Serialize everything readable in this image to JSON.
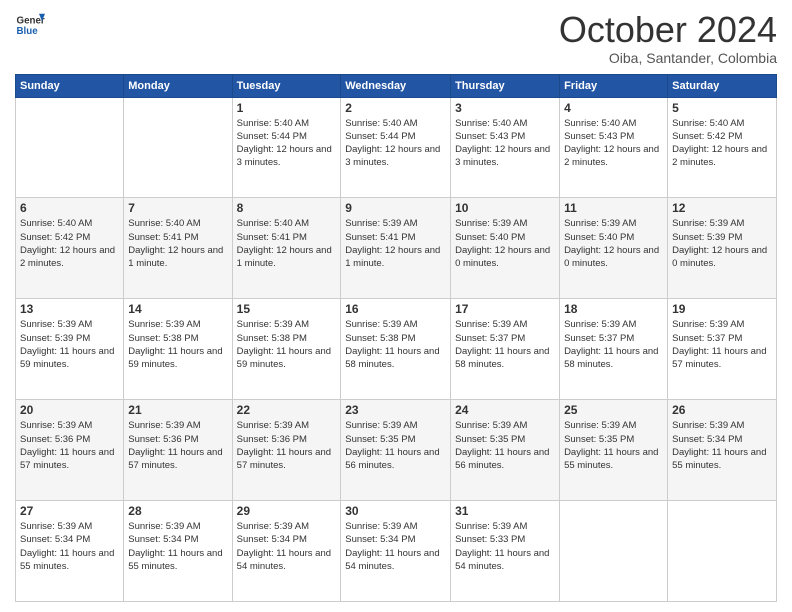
{
  "logo": {
    "line1": "General",
    "line2": "Blue"
  },
  "title": "October 2024",
  "location": "Oiba, Santander, Colombia",
  "weekdays": [
    "Sunday",
    "Monday",
    "Tuesday",
    "Wednesday",
    "Thursday",
    "Friday",
    "Saturday"
  ],
  "weeks": [
    [
      {
        "day": "",
        "info": ""
      },
      {
        "day": "",
        "info": ""
      },
      {
        "day": "1",
        "info": "Sunrise: 5:40 AM\nSunset: 5:44 PM\nDaylight: 12 hours\nand 3 minutes."
      },
      {
        "day": "2",
        "info": "Sunrise: 5:40 AM\nSunset: 5:44 PM\nDaylight: 12 hours\nand 3 minutes."
      },
      {
        "day": "3",
        "info": "Sunrise: 5:40 AM\nSunset: 5:43 PM\nDaylight: 12 hours\nand 3 minutes."
      },
      {
        "day": "4",
        "info": "Sunrise: 5:40 AM\nSunset: 5:43 PM\nDaylight: 12 hours\nand 2 minutes."
      },
      {
        "day": "5",
        "info": "Sunrise: 5:40 AM\nSunset: 5:42 PM\nDaylight: 12 hours\nand 2 minutes."
      }
    ],
    [
      {
        "day": "6",
        "info": "Sunrise: 5:40 AM\nSunset: 5:42 PM\nDaylight: 12 hours\nand 2 minutes."
      },
      {
        "day": "7",
        "info": "Sunrise: 5:40 AM\nSunset: 5:41 PM\nDaylight: 12 hours\nand 1 minute."
      },
      {
        "day": "8",
        "info": "Sunrise: 5:40 AM\nSunset: 5:41 PM\nDaylight: 12 hours\nand 1 minute."
      },
      {
        "day": "9",
        "info": "Sunrise: 5:39 AM\nSunset: 5:41 PM\nDaylight: 12 hours\nand 1 minute."
      },
      {
        "day": "10",
        "info": "Sunrise: 5:39 AM\nSunset: 5:40 PM\nDaylight: 12 hours\nand 0 minutes."
      },
      {
        "day": "11",
        "info": "Sunrise: 5:39 AM\nSunset: 5:40 PM\nDaylight: 12 hours\nand 0 minutes."
      },
      {
        "day": "12",
        "info": "Sunrise: 5:39 AM\nSunset: 5:39 PM\nDaylight: 12 hours\nand 0 minutes."
      }
    ],
    [
      {
        "day": "13",
        "info": "Sunrise: 5:39 AM\nSunset: 5:39 PM\nDaylight: 11 hours\nand 59 minutes."
      },
      {
        "day": "14",
        "info": "Sunrise: 5:39 AM\nSunset: 5:38 PM\nDaylight: 11 hours\nand 59 minutes."
      },
      {
        "day": "15",
        "info": "Sunrise: 5:39 AM\nSunset: 5:38 PM\nDaylight: 11 hours\nand 59 minutes."
      },
      {
        "day": "16",
        "info": "Sunrise: 5:39 AM\nSunset: 5:38 PM\nDaylight: 11 hours\nand 58 minutes."
      },
      {
        "day": "17",
        "info": "Sunrise: 5:39 AM\nSunset: 5:37 PM\nDaylight: 11 hours\nand 58 minutes."
      },
      {
        "day": "18",
        "info": "Sunrise: 5:39 AM\nSunset: 5:37 PM\nDaylight: 11 hours\nand 58 minutes."
      },
      {
        "day": "19",
        "info": "Sunrise: 5:39 AM\nSunset: 5:37 PM\nDaylight: 11 hours\nand 57 minutes."
      }
    ],
    [
      {
        "day": "20",
        "info": "Sunrise: 5:39 AM\nSunset: 5:36 PM\nDaylight: 11 hours\nand 57 minutes."
      },
      {
        "day": "21",
        "info": "Sunrise: 5:39 AM\nSunset: 5:36 PM\nDaylight: 11 hours\nand 57 minutes."
      },
      {
        "day": "22",
        "info": "Sunrise: 5:39 AM\nSunset: 5:36 PM\nDaylight: 11 hours\nand 57 minutes."
      },
      {
        "day": "23",
        "info": "Sunrise: 5:39 AM\nSunset: 5:35 PM\nDaylight: 11 hours\nand 56 minutes."
      },
      {
        "day": "24",
        "info": "Sunrise: 5:39 AM\nSunset: 5:35 PM\nDaylight: 11 hours\nand 56 minutes."
      },
      {
        "day": "25",
        "info": "Sunrise: 5:39 AM\nSunset: 5:35 PM\nDaylight: 11 hours\nand 55 minutes."
      },
      {
        "day": "26",
        "info": "Sunrise: 5:39 AM\nSunset: 5:34 PM\nDaylight: 11 hours\nand 55 minutes."
      }
    ],
    [
      {
        "day": "27",
        "info": "Sunrise: 5:39 AM\nSunset: 5:34 PM\nDaylight: 11 hours\nand 55 minutes."
      },
      {
        "day": "28",
        "info": "Sunrise: 5:39 AM\nSunset: 5:34 PM\nDaylight: 11 hours\nand 55 minutes."
      },
      {
        "day": "29",
        "info": "Sunrise: 5:39 AM\nSunset: 5:34 PM\nDaylight: 11 hours\nand 54 minutes."
      },
      {
        "day": "30",
        "info": "Sunrise: 5:39 AM\nSunset: 5:34 PM\nDaylight: 11 hours\nand 54 minutes."
      },
      {
        "day": "31",
        "info": "Sunrise: 5:39 AM\nSunset: 5:33 PM\nDaylight: 11 hours\nand 54 minutes."
      },
      {
        "day": "",
        "info": ""
      },
      {
        "day": "",
        "info": ""
      }
    ]
  ]
}
